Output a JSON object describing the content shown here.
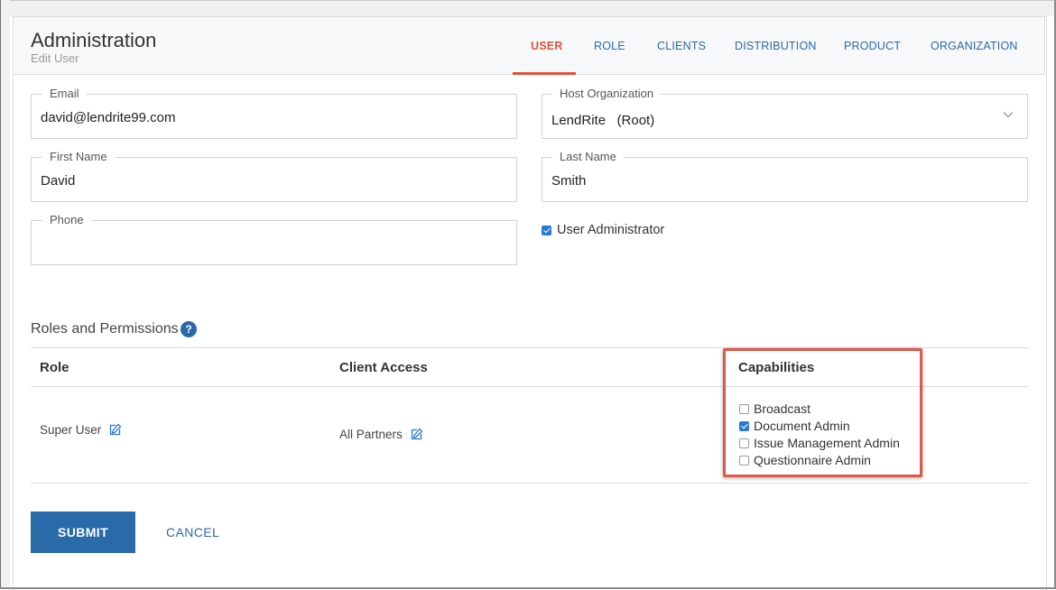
{
  "header": {
    "title": "Administration",
    "subtitle": "Edit User"
  },
  "tabs": [
    {
      "label": "USER",
      "active": true
    },
    {
      "label": "ROLE",
      "active": false
    },
    {
      "label": "CLIENTS",
      "active": false
    },
    {
      "label": "DISTRIBUTION",
      "active": false
    },
    {
      "label": "PRODUCT",
      "active": false
    },
    {
      "label": "ORGANIZATION",
      "active": false
    }
  ],
  "form": {
    "email": {
      "label": "Email",
      "value": "david@lendrite99.com"
    },
    "host_org": {
      "label": "Host Organization",
      "value": "LendRite   (Root)"
    },
    "first_name": {
      "label": "First Name",
      "value": "David"
    },
    "last_name": {
      "label": "Last Name",
      "value": "Smith"
    },
    "phone": {
      "label": "Phone",
      "value": ""
    },
    "user_admin": {
      "label": "User Administrator",
      "checked": true
    }
  },
  "roles": {
    "section_title": "Roles and Permissions",
    "help_glyph": "?",
    "columns": [
      "Role",
      "Client Access",
      "Capabilities"
    ],
    "row": {
      "role": "Super User",
      "client_access": "All Partners",
      "capabilities": [
        {
          "label": "Broadcast",
          "checked": false
        },
        {
          "label": "Document Admin",
          "checked": true
        },
        {
          "label": "Issue Management Admin",
          "checked": false
        },
        {
          "label": "Questionnaire Admin",
          "checked": false
        }
      ]
    }
  },
  "actions": {
    "submit": "SUBMIT",
    "cancel": "CANCEL"
  },
  "colors": {
    "accent": "#e0533b",
    "link": "#2a6aa8",
    "checkbox": "#2a7ad2",
    "highlight": "#e0584a"
  }
}
